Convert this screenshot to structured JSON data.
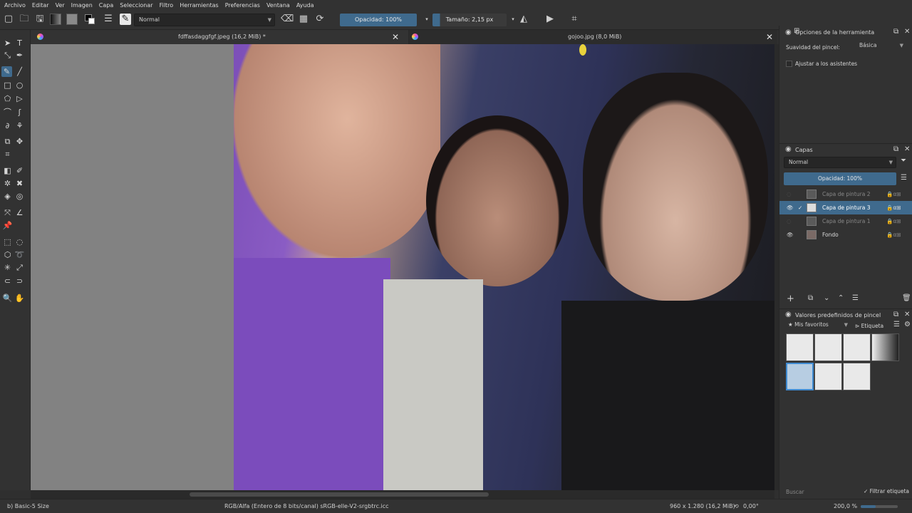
{
  "menu": [
    "Archivo",
    "Editar",
    "Ver",
    "Imagen",
    "Capa",
    "Seleccionar",
    "Filtro",
    "Herramientas",
    "Preferencias",
    "Ventana",
    "Ayuda"
  ],
  "toolbar": {
    "blend_mode": "Normal",
    "opacity_label": "Opacidad: 100%",
    "size_label": "Tamaño: 2,15 px"
  },
  "tabs": [
    {
      "title": "fdffasdaggfgf.jpeg (16,2 MiB) *"
    },
    {
      "title": "gojoo.jpg (8,0 MiB)"
    }
  ],
  "tool_options": {
    "title": "Opciones de la herramienta",
    "smoothing_label": "Suavidad del pincel:",
    "smoothing_value": "Básica",
    "snap_label": "Ajustar a los asistentes"
  },
  "layers": {
    "title": "Capas",
    "blend_mode": "Normal",
    "opacity_label": "Opacidad:  100%",
    "items": [
      {
        "name": "Capa de pintura 2",
        "visible": false,
        "selected": false
      },
      {
        "name": "Capa de pintura 3",
        "visible": true,
        "selected": true
      },
      {
        "name": "Capa de pintura 1",
        "visible": false,
        "selected": false
      },
      {
        "name": "Fondo",
        "visible": true,
        "selected": false
      }
    ]
  },
  "brush_presets": {
    "title": "Valores predefinidos de pincel",
    "tag": "Mis favoritos",
    "tag_label": "Etiqueta",
    "search_placeholder": "Buscar",
    "filter_label": "Filtrar etiqueta"
  },
  "status": {
    "brush": "b) Basic-5 Size",
    "color_model": "RGB/Alfa (Entero de 8 bits/canal)  sRGB-elle-V2-srgbtrc.icc",
    "dimensions": "960 x 1.280 (16,2 MiB)",
    "rotation": "0,00°",
    "zoom": "200,0 %"
  },
  "colors": {
    "accent": "#3f6a8d",
    "panel": "#323232",
    "canvas_bg": "#828282"
  }
}
